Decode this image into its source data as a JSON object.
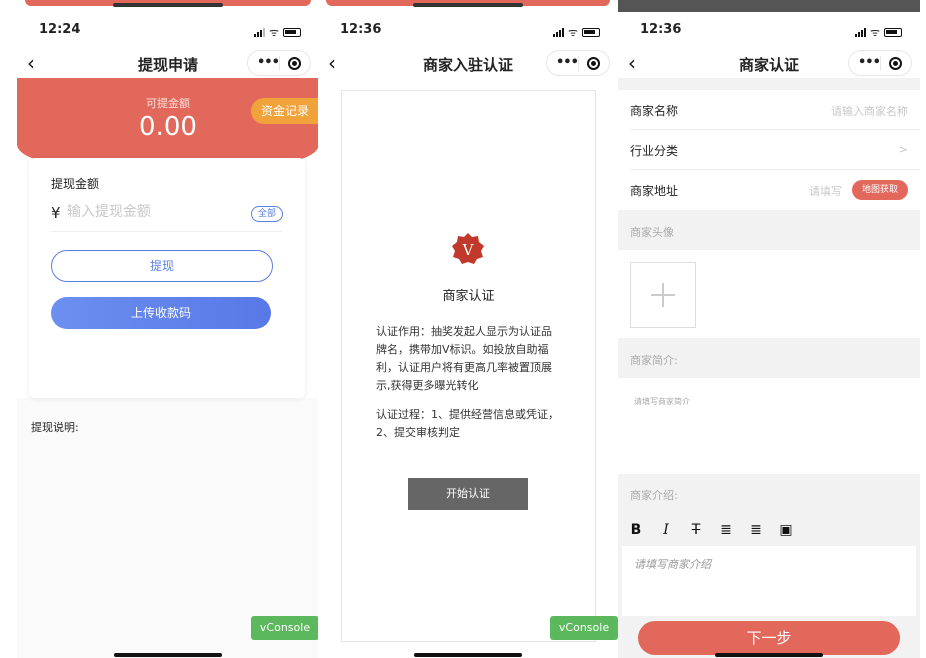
{
  "colors": {
    "accent": "#e2685c",
    "blue": "#5b7fe0",
    "orange": "#f2a23a",
    "green": "#5cb85c"
  },
  "panel1": {
    "time": "12:24",
    "title": "提现申请",
    "available_label": "可提金额",
    "available_amount": "0.00",
    "fund_record_btn": "资金记录",
    "amount_label": "提现金额",
    "currency": "¥",
    "amount_placeholder": "输入提现金额",
    "all_btn": "全部",
    "withdraw_btn": "提现",
    "upload_btn": "上传收款码",
    "note_label": "提现说明:",
    "vconsole": "vConsole"
  },
  "panel2": {
    "time": "12:36",
    "title": "商家入驻认证",
    "badge_letter": "V",
    "heading": "商家认证",
    "purpose": "认证作用：抽奖发起人显示为认证品牌名，携带加V标识。如投放自助福利，认证用户将有更高几率被置顶展示,获得更多曝光转化",
    "process": "认证过程：1、提供经营信息或凭证，2、提交审核判定",
    "start_btn": "开始认证",
    "vconsole": "vConsole"
  },
  "panel3": {
    "time": "12:36",
    "title": "商家认证",
    "name_label": "商家名称",
    "name_placeholder": "请输入商家名称",
    "industry_label": "行业分类",
    "industry_chevron": ">",
    "address_label": "商家地址",
    "address_placeholder": "请填写",
    "map_btn": "地图获取",
    "avatar_label": "商家头像",
    "brief_label": "商家简介:",
    "brief_placeholder": "请填写商家简介",
    "intro_label": "商家介绍:",
    "intro_placeholder": "请填写商家介绍",
    "next_btn": "下一步",
    "toolbar": [
      "B",
      "I",
      "T",
      "≣",
      "≣",
      "▣"
    ]
  }
}
